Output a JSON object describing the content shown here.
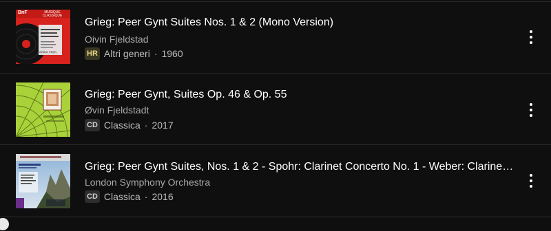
{
  "albums": [
    {
      "title": "Grieg: Peer Gynt Suites Nos. 1 & 2 (Mono Version)",
      "artist": "Oivin Fjeldstad",
      "badge": "HR",
      "genre": "Altri generi",
      "year": "1960",
      "cover_text": [
        "BnF",
        "MUSIQUE CLASSIQUE",
        "GRIEG PEER GYNT SUITES NOS. 1&2"
      ]
    },
    {
      "title": "Grieg: Peer Gynt, Suites Op. 46 & Op. 55",
      "artist": "Øvin Fjeldstadt",
      "badge": "CD",
      "genre": "Classica",
      "year": "2017"
    },
    {
      "title": "Grieg: Peer Gynt Suites, Nos. 1 & 2 - Spohr: Clarinet Concerto No. 1 - Weber: Clarinet Co...",
      "artist": "London Symphony Orchestra",
      "badge": "CD",
      "genre": "Classica",
      "year": "2016"
    }
  ],
  "separator": "·",
  "icons": {
    "more": "more-vertical-icon"
  }
}
